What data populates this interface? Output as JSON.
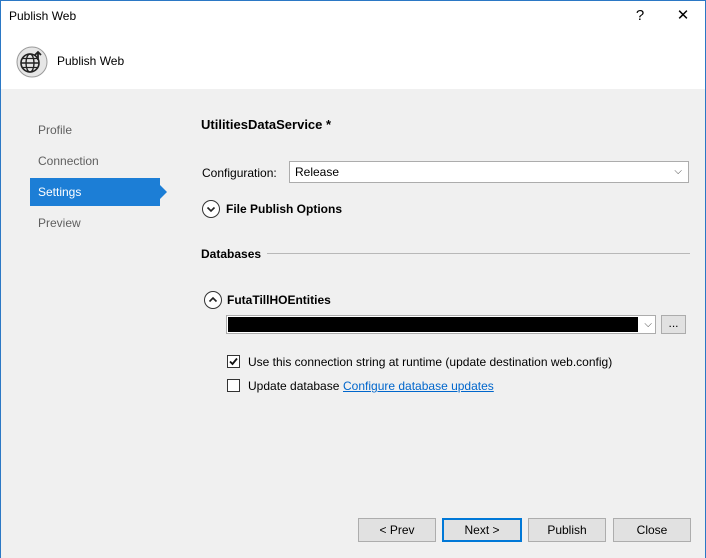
{
  "window": {
    "title": "Publish Web",
    "help": "?",
    "close": "✕"
  },
  "header": {
    "title": "Publish Web",
    "icon": "globe-publish-icon"
  },
  "nav": {
    "items": [
      {
        "label": "Profile",
        "selected": false
      },
      {
        "label": "Connection",
        "selected": false
      },
      {
        "label": "Settings",
        "selected": true
      },
      {
        "label": "Preview",
        "selected": false
      }
    ]
  },
  "settings": {
    "profile_name": "UtilitiesDataService *",
    "configuration_label": "Configuration:",
    "configuration_value": "Release",
    "file_publish_options": "File Publish Options",
    "databases_label": "Databases",
    "entity_name": "FutaTillHOEntities",
    "ellipsis": "...",
    "use_conn_string_label": "Use this connection string at runtime (update destination web.config)",
    "use_conn_string_checked": true,
    "update_database_label": "Update database",
    "update_database_checked": false,
    "configure_link": "Configure database updates"
  },
  "buttons": {
    "prev": "< Prev",
    "next": "Next >",
    "publish": "Publish",
    "close": "Close"
  },
  "colors": {
    "accent": "#1c7ed6",
    "link": "#0066cc",
    "panel_bg": "#f0f0f0"
  }
}
